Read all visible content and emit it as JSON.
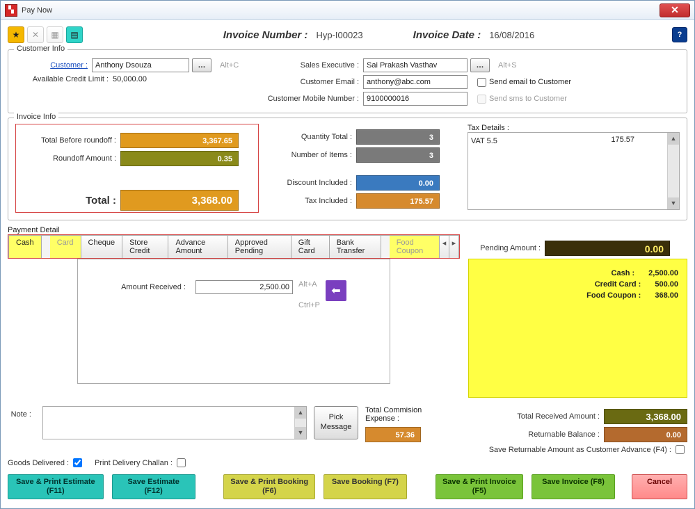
{
  "window_title": "Pay Now",
  "header": {
    "invoice_number_lbl": "Invoice Number  :",
    "invoice_number": "Hyp-I00023",
    "invoice_date_lbl": "Invoice Date :",
    "invoice_date": "16/08/2016"
  },
  "toolbar": {
    "new": "New",
    "close": "✕",
    "grid": "▦",
    "calc": "▤"
  },
  "customer": {
    "panel_title": "Customer Info",
    "customer_lbl": "Customer :",
    "customer_name": "Anthony Dsouza",
    "alt_c": "Alt+C",
    "credit_lbl": "Available Credit Limit :",
    "credit_value": "50,000.00",
    "exec_lbl": "Sales Executive :",
    "exec_name": "Sai Prakash Vasthav",
    "alt_s": "Alt+S",
    "email_lbl": "Customer Email :",
    "email": "anthony@abc.com",
    "send_email_lbl": "Send email to Customer",
    "mobile_lbl": "Customer Mobile Number :",
    "mobile": "9100000016",
    "send_sms_lbl": "Send sms to Customer"
  },
  "invoice": {
    "panel_title": "Invoice Info",
    "before_lbl": "Total  Before roundoff :",
    "before_val": "3,367.65",
    "roundoff_lbl": "Roundoff Amount :",
    "roundoff_val": "0.35",
    "total_lbl": "Total :",
    "total_val": "3,368.00",
    "qty_lbl": "Quantity Total :",
    "qty_val": "3",
    "items_lbl": "Number of Items :",
    "items_val": "3",
    "disc_lbl": "Discount Included :",
    "disc_val": "0.00",
    "tax_lbl": "Tax Included :",
    "tax_val": "175.57",
    "taxdet_lbl": "Tax Details :",
    "tax_name": "VAT 5.5",
    "tax_amount": "175.57"
  },
  "payment": {
    "panel_title": "Payment Detail",
    "tabs": [
      "Cash",
      "Card",
      "Cheque",
      "Store Credit",
      "Advance Amount",
      "Approved Pending",
      "Gift Card",
      "Bank Transfer",
      "Food Coupon"
    ],
    "amount_lbl": "Amount Received :",
    "amount_val": "2,500.00",
    "alt_a": "Alt+A",
    "ctrl_p": "Ctrl+P",
    "pending_lbl": "Pending Amount :",
    "pending_val": "0.00",
    "lines": [
      [
        "Cash :",
        "2,500.00"
      ],
      [
        "Credit Card :",
        "500.00"
      ],
      [
        "Food Coupon :",
        "368.00"
      ]
    ]
  },
  "bottom": {
    "note_lbl": "Note :",
    "pick_msg": "Pick Message",
    "comm_lbl": "Total Commision Expense :",
    "comm_val": "57.36",
    "recv_lbl": "Total Received  Amount :",
    "recv_val": "3,368.00",
    "ret_lbl": "Returnable Balance :",
    "ret_val": "0.00",
    "save_ret_lbl": "Save Returnable Amount as Customer Advance (F4)  :",
    "goods_lbl": "Goods Delivered :",
    "print_chal_lbl": "Print Delivery Challan :"
  },
  "buttons": {
    "est_print": "Save & Print Estimate (F11)",
    "est": "Save Estimate (F12)",
    "book_print": "Save & Print Booking (F6)",
    "book": "Save Booking (F7)",
    "inv_print": "Save & Print Invoice (F5)",
    "inv": "Save Invoice (F8)",
    "cancel": "Cancel"
  }
}
